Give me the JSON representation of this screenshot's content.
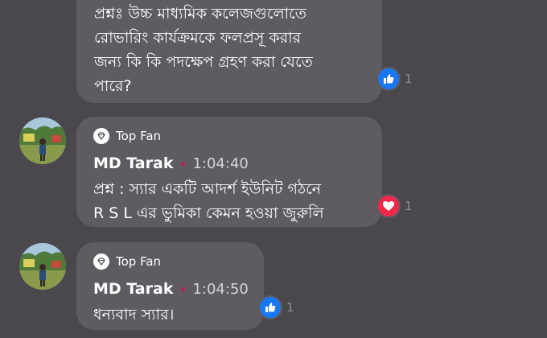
{
  "comments": [
    {
      "text_lines": [
        "প্রশ্নঃ উচ্চ মাধ্যমিক কলেজগুলোতে",
        "রোভারিং কার্যক্রমকে ফলপ্রসূ করার",
        "জন্য কি কি পদক্ষেপ গ্রহণ করা যেতে",
        "পারে?"
      ],
      "reaction": {
        "type": "like",
        "icon": "thumbs-up-icon",
        "count": "1"
      }
    },
    {
      "badge": "Top Fan",
      "author": "MD Tarak",
      "timestamp": "1:04:40",
      "text_lines": [
        "প্রশ্ন : স্যার  একটি আদর্শ ইউনিট গঠনে",
        "R S L এর ভুমিকা কেমন হওয়া জুরুলি"
      ],
      "reaction": {
        "type": "love",
        "icon": "heart-icon",
        "count": "1"
      }
    },
    {
      "badge": "Top Fan",
      "author": "MD Tarak",
      "timestamp": "1:04:50",
      "text_lines": [
        "ধন্যবাদ স্যার।"
      ],
      "reaction": {
        "type": "like",
        "icon": "thumbs-up-icon",
        "count": "1"
      }
    }
  ],
  "colors": {
    "background": "#4a474d",
    "bubble": "#5e5b61",
    "like": "#1877f2",
    "love": "#f02849",
    "dot": "#c2185b"
  }
}
